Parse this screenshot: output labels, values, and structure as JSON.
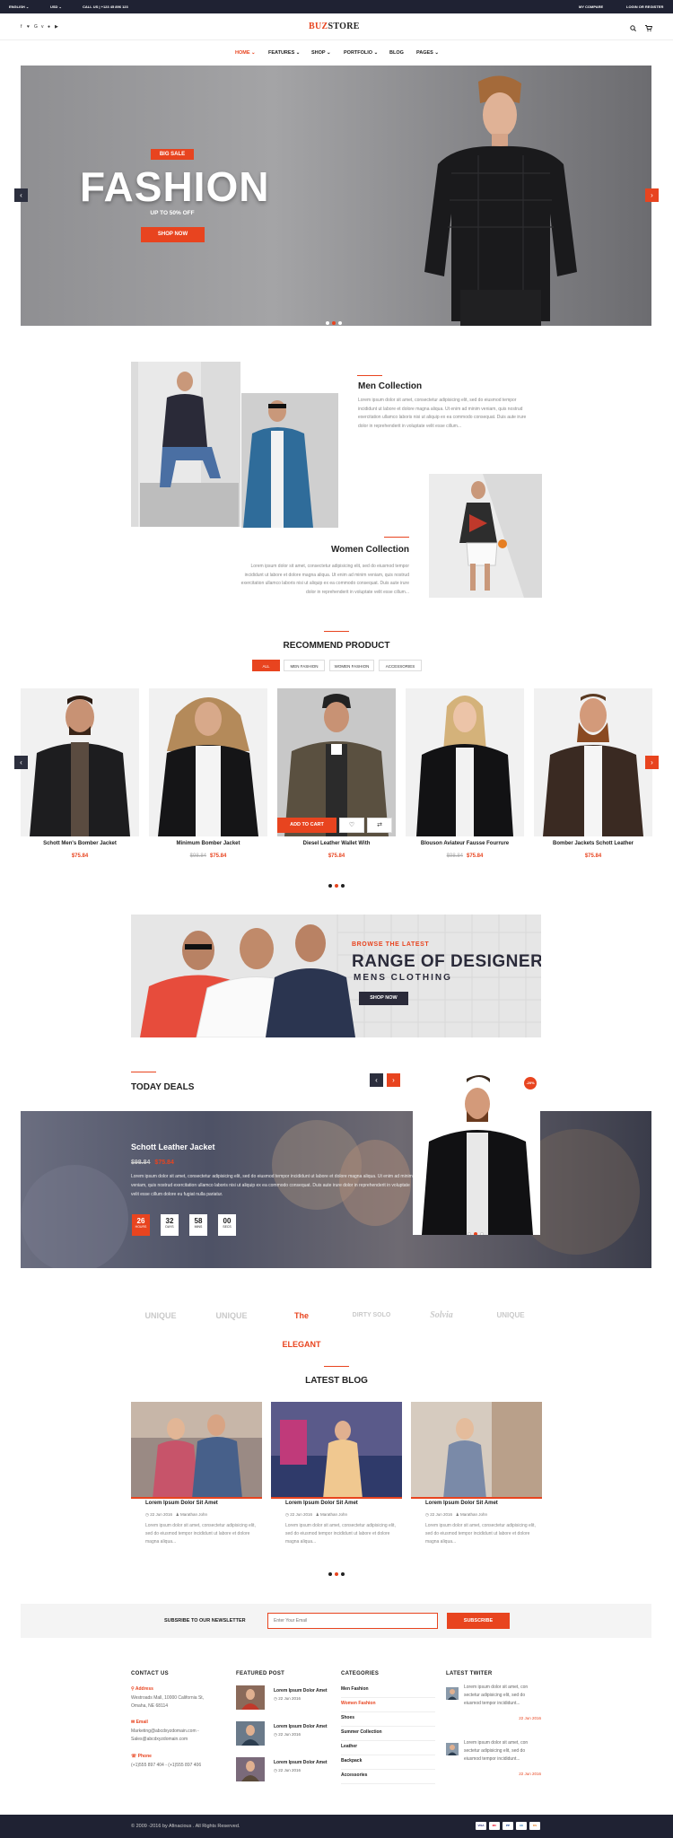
{
  "topbar": {
    "language": "ENGLISH ⌄",
    "currency": "USD ⌄",
    "phone": "CALL US | +123 45 896 123",
    "compare": "MY COMPARE",
    "account": "LOGIN OR REGISTER"
  },
  "header": {
    "logo_a": "BUZ",
    "logo_b": "STORE"
  },
  "nav": [
    "HOME ⌄",
    "FEATURES ⌄",
    "SHOP ⌄",
    "PORTFOLIO ⌄",
    "BLOG",
    "PAGES ⌄"
  ],
  "hero": {
    "badge": "BIG SALE",
    "title": "FASHION",
    "subtitle": "UP TO 50% OFF",
    "cta": "SHOP NOW"
  },
  "collections": {
    "men_title": "Men Collection",
    "men_text": "Lorem ipsum dolor sit amet, consectetur adipisicing elit, sed do eiusmod tempor incididunt ut labore et dolore magna aliqua. Ut enim ad minim veniam, quis nostrud exercitation ullamco laboris nisi ut aliquip ex ea commodo consequat. Duis aute irure dolor in reprehenderit in voluptate velit esse cillum...",
    "women_title": "Women Collection",
    "women_text": "Lorem ipsum dolor sit amet, consectetur adipisicing elit, sed do eiusmod tempor incididunt ut labore et dolore magna aliqua. Ut enim ad minim veniam, quis nostrud exercitation ullamco laboris nisi ut aliquip ex ea commodo consequat. Duis aute irure dolor in reprehenderit in voluptate velit esse cillum..."
  },
  "recommend": {
    "title": "RECOMMEND PRODUCT",
    "tabs": [
      "ALL",
      "MEN FASHION",
      "WOMEN FASHION",
      "ACCESSORIES"
    ],
    "add_to_cart": "ADD TO CART",
    "products": [
      {
        "name": "Schott Men's Bomber Jacket",
        "old": "",
        "price": "$75.84"
      },
      {
        "name": "Minimum Bomber Jacket",
        "old": "$98.84",
        "price": "$75.84"
      },
      {
        "name": "Diesel Leather Wallet With",
        "old": "",
        "price": "$75.84"
      },
      {
        "name": "Blouson Aviateur Fausse Fourrure",
        "old": "$98.84",
        "price": "$75.84"
      },
      {
        "name": "Bomber Jackets Schott Leather",
        "old": "",
        "price": "$75.84"
      }
    ]
  },
  "banner": {
    "line1": "BROWSE THE LATEST",
    "line2": "RANGE OF DESIGNER",
    "line3": "MENS CLOTHING",
    "cta": "SHOP NOW"
  },
  "deals": {
    "title": "TODAY DEALS",
    "product": "Schott Leather Jacket",
    "old": "$98.84",
    "price": "$75.84",
    "text": "Lorem ipsum dolor sit amet, consectetur adipisicing elit, sed do eiusmod tempor incididunt ut labore et dolore magna aliqua. Ut enim ad minim veniam, quis nostrud exercitation ullamco laboris nisi ut aliquip ex ea commodo consequat. Duis aute irure dolor in reprehenderit in voluptate velit esse cillum dolore eu fugiat nulla pariatur.",
    "badge": "-20%",
    "countdown": [
      {
        "v": "26",
        "l": "HOURS"
      },
      {
        "v": "32",
        "l": "DAYS"
      },
      {
        "v": "58",
        "l": "MINS"
      },
      {
        "v": "00",
        "l": "SECS"
      }
    ]
  },
  "brands": [
    "UNIQUE",
    "UNIQUE",
    "The ELEGANT",
    "DIRTY SOLO",
    "Solvia",
    "UNIQUE"
  ],
  "blog": {
    "title": "LATEST BLOG",
    "posts": [
      {
        "title": "Lorem Ipsum Dolor Sit Amet",
        "date": "22 Jun 2016",
        "author": "Marathan John",
        "text": "Lorem ipsum dolor sit amet, consectetur adipisicing elit, sed do eiusmod tempor incididunt ut labore et dolore magna aliqua..."
      },
      {
        "title": "Lorem Ipsum Dolor Sit Amet",
        "date": "22 Jun 2016",
        "author": "Marathan John",
        "text": "Lorem ipsum dolor sit amet, consectetur adipisicing elit, sed do eiusmod tempor incididunt ut labore et dolore magna aliqua..."
      },
      {
        "title": "Lorem Ipsum Dolor Sit Amet",
        "date": "22 Jun 2016",
        "author": "Marathan John",
        "text": "Lorem ipsum dolor sit amet, consectetur adipisicing elit, sed do eiusmod tempor incididunt ut labore et dolore magna aliqua..."
      }
    ]
  },
  "newsletter": {
    "label": "SUBSRIBE TO OUR NEWSLETTER",
    "placeholder": "Enter Your Email",
    "button": "SUBSCRIBE"
  },
  "footer": {
    "contact": {
      "title": "CONTACT US",
      "addr_label": "Address",
      "addr": "Westroads Mall, 10000 California St, Omaha, NE 68114",
      "email_label": "Email",
      "email": "Marketing@abcdxyzdomain.com - Sales@abcdxyzdomain.com",
      "phone_label": "Phone",
      "phone": "(+1)555 897 404 - (+1)555 897 406"
    },
    "featured": {
      "title": "FEATURED POST",
      "posts": [
        {
          "t": "Lorem Ipsum Dolor Amet",
          "d": "22 Jun 2016"
        },
        {
          "t": "Lorem Ipsum Dolor Amet",
          "d": "22 Jun 2016"
        },
        {
          "t": "Lorem Ipsum Dolor Amet",
          "d": "22 Jun 2016"
        }
      ]
    },
    "categories": {
      "title": "CATEGORIES",
      "items": [
        "Men Fashion",
        "Women Fashion",
        "Shoes",
        "Summer Collection",
        "Leather",
        "Backpack",
        "Accessories"
      ]
    },
    "twitter": {
      "title": "LATEST TWITER",
      "tweets": [
        {
          "t": "Lorem ipsum dolor sit amet, con sectetur adipisicing elit, sed do eiusmod tempor incididunt...",
          "d": "22 Jun 2016"
        },
        {
          "t": "Lorem ipsum dolor sit amet, con sectetur adipisicing elit, sed do eiusmod tempor incididunt...",
          "d": "22 Jun 2016"
        }
      ]
    }
  },
  "bottom": {
    "copyright": "© 2009 -2016 by Afinacious . All Rights Reserved.",
    "payments": [
      "VISA",
      "MC",
      "PP",
      "AE",
      "DS"
    ]
  },
  "colors": {
    "accent": "#e8441f",
    "dark": "#1f2233"
  }
}
